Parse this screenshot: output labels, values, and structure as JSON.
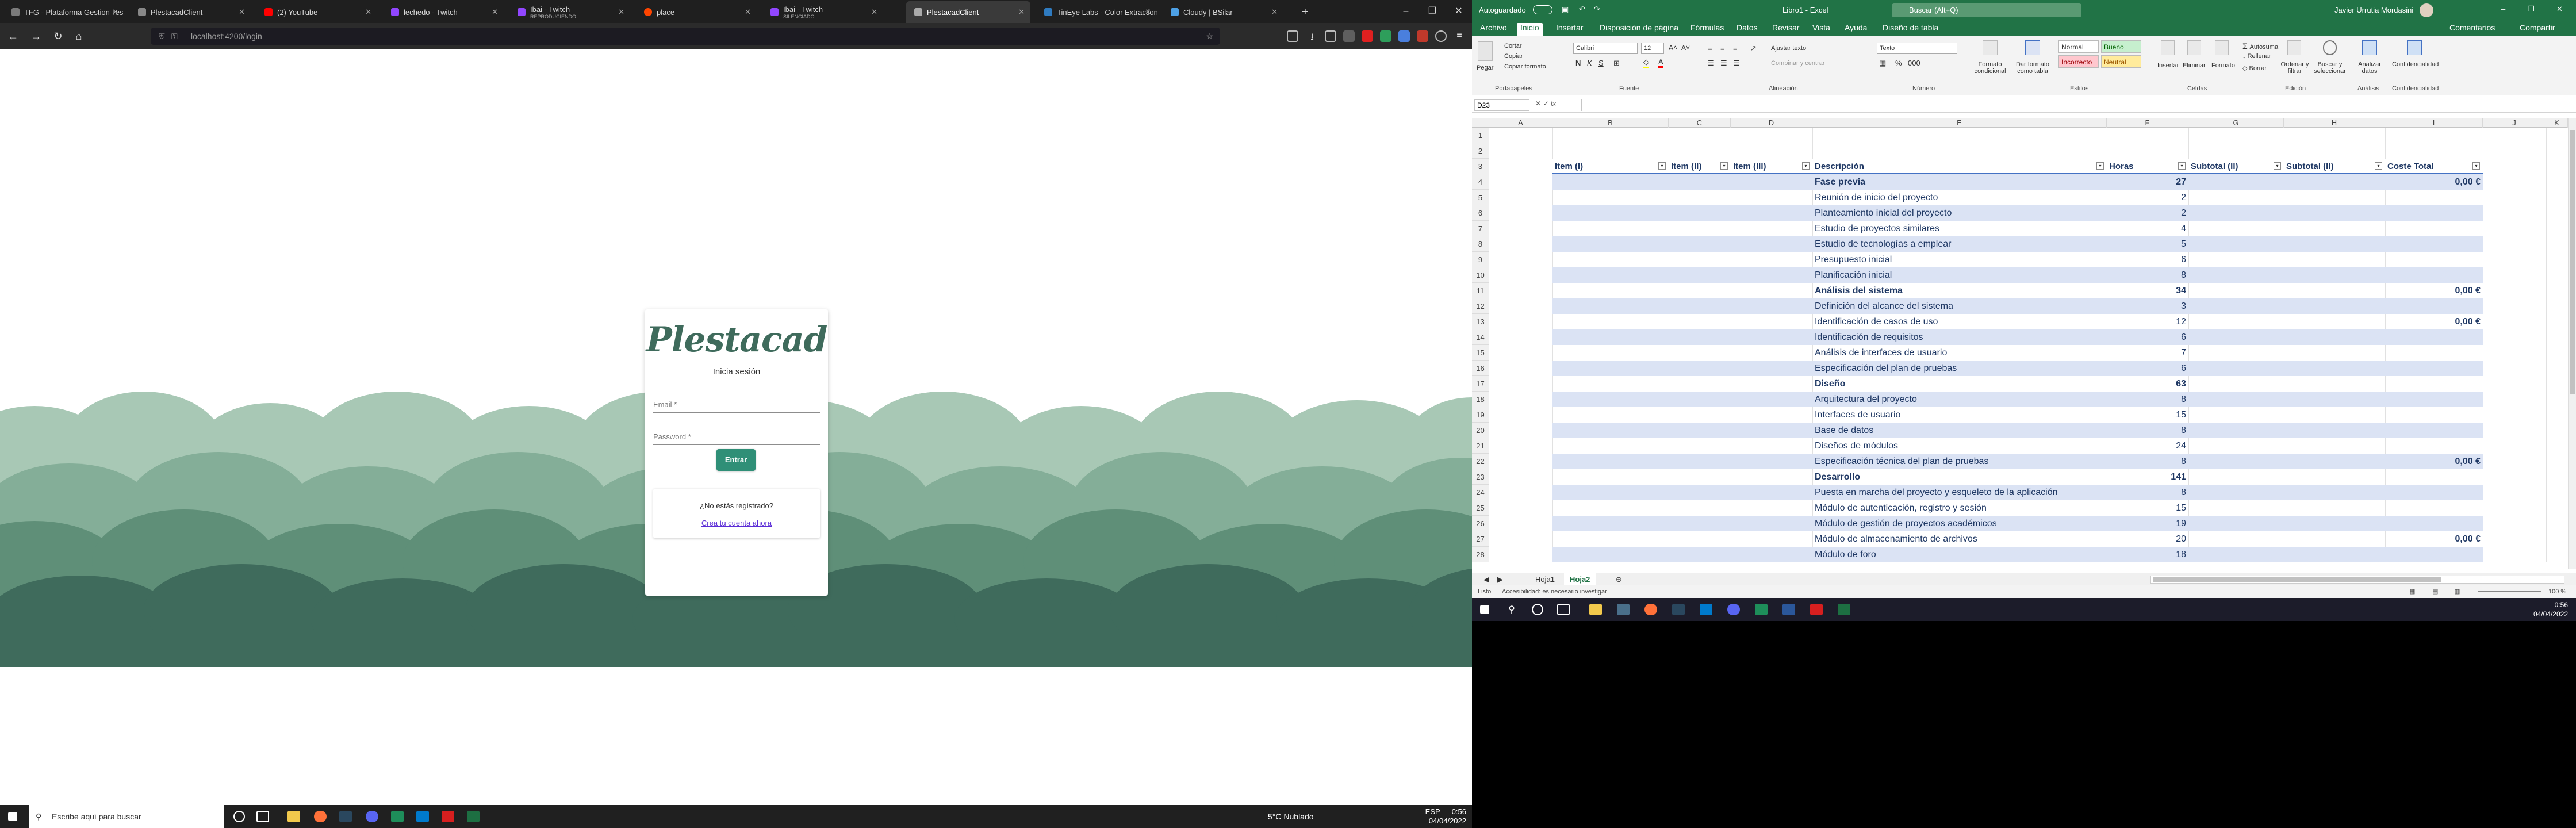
{
  "browser": {
    "tabs": [
      {
        "label": "TFG - Plataforma Gestion Tes",
        "color": "#7a7a7a",
        "sub": ""
      },
      {
        "label": "PlestacadClient",
        "color": "#888888",
        "sub": ""
      },
      {
        "label": "(2) YouTube",
        "color": "#ff0000",
        "sub": ""
      },
      {
        "label": "lechedo - Twitch",
        "color": "#9146ff",
        "sub": ""
      },
      {
        "label": "Ibai - Twitch",
        "color": "#9146ff",
        "sub": "REPRODUCIENDO"
      },
      {
        "label": "place",
        "color": "#ff4500",
        "sub": ""
      },
      {
        "label": "Ibai - Twitch",
        "color": "#9146ff",
        "sub": "SILENCIADO"
      },
      {
        "label": "PlestacadClient",
        "color": "#888888",
        "sub": ""
      },
      {
        "label": "TinEye Labs - Color Extraction",
        "color": "#2f7bc0",
        "sub": ""
      },
      {
        "label": "Cloudy | BSilar",
        "color": "#4da1e6",
        "sub": ""
      }
    ],
    "url": "localhost:4200/login",
    "login": {
      "logo": "Plestacad",
      "subtitle": "Inicia sesión",
      "email_label": "Email *",
      "password_label": "Password *",
      "submit": "Entrar",
      "register_question": "¿No estás registrado?",
      "register_link": "Crea tu cuenta ahora"
    }
  },
  "taskbar_left": {
    "search_placeholder": "Escribe aquí para buscar",
    "weather": "5°C  Nublado",
    "lang": "ESP",
    "time": "0:56",
    "date": "04/04/2022"
  },
  "excel": {
    "title": "Libro1 - Excel",
    "autosave": "Autoguardado",
    "search": "Buscar (Alt+Q)",
    "user": "Javier Urrutia Mordasini",
    "menu": [
      "Archivo",
      "Inicio",
      "Insertar",
      "Disposición de página",
      "Fórmulas",
      "Datos",
      "Revisar",
      "Vista",
      "Ayuda",
      "Diseño de tabla"
    ],
    "comments": "Comentarios",
    "share": "Compartir",
    "ribbon": {
      "clipboard": "Portapapeles",
      "cut": "Cortar",
      "copy": "Copiar",
      "format_painter": "Copiar formato",
      "paste": "Pegar",
      "font_group": "Fuente",
      "font": "Calibri",
      "font_size": "12",
      "align_group": "Alineación",
      "wrap": "Ajustar texto",
      "merge": "Combinar y centrar",
      "number_group": "Número",
      "number_format": "Texto",
      "styles_group": "Estilos",
      "cond_format": "Formato condicional",
      "as_table": "Dar formato como tabla",
      "style_normal": "Normal",
      "style_good": "Bueno",
      "style_bad": "Incorrecto",
      "style_neutral": "Neutral",
      "cells_group": "Celdas",
      "insert": "Insertar",
      "delete": "Eliminar",
      "format": "Formato",
      "edit_group": "Edición",
      "autosum": "Autosuma",
      "fill": "Rellenar",
      "clear": "Borrar",
      "sort": "Ordenar y filtrar",
      "find": "Buscar y seleccionar",
      "analysis_group": "Análisis",
      "analyze": "Analizar datos",
      "sens_group": "Confidencialidad",
      "sensitivity": "Confidencialidad"
    },
    "namebox": "D23",
    "columns": [
      "A",
      "B",
      "C",
      "D",
      "E",
      "F",
      "G",
      "H",
      "I",
      "J",
      "K"
    ],
    "headers": [
      "Item (I)",
      "Item (II)",
      "Item (III)",
      "Descripción",
      "Horas",
      "Subtotal (II)",
      "Subtotal (II)",
      "Coste Total"
    ],
    "rows": [
      {
        "n": "1",
        "desc": "",
        "hours": "",
        "cost": "",
        "bold": false,
        "band": "none"
      },
      {
        "n": "2",
        "desc": "",
        "hours": "",
        "cost": "",
        "bold": false,
        "band": "none"
      },
      {
        "n": "3",
        "desc": "",
        "hours": "",
        "cost": "",
        "bold": false,
        "band": "header"
      },
      {
        "n": "4",
        "desc": "Fase previa",
        "hours": "27",
        "cost": "0,00 €",
        "bold": true,
        "band": "alt"
      },
      {
        "n": "5",
        "desc": "Reunión de inicio del proyecto",
        "hours": "2",
        "cost": "",
        "bold": false,
        "band": "plain"
      },
      {
        "n": "6",
        "desc": "Planteamiento inicial del proyecto",
        "hours": "2",
        "cost": "",
        "bold": false,
        "band": "alt"
      },
      {
        "n": "7",
        "desc": "Estudio de proyectos similares",
        "hours": "4",
        "cost": "",
        "bold": false,
        "band": "plain"
      },
      {
        "n": "8",
        "desc": "Estudio de tecnologías a emplear",
        "hours": "5",
        "cost": "",
        "bold": false,
        "band": "alt"
      },
      {
        "n": "9",
        "desc": "Presupuesto inicial",
        "hours": "6",
        "cost": "",
        "bold": false,
        "band": "plain"
      },
      {
        "n": "10",
        "desc": "Planificación inicial",
        "hours": "8",
        "cost": "",
        "bold": false,
        "band": "alt"
      },
      {
        "n": "11",
        "desc": "Análisis del sistema",
        "hours": "34",
        "cost": "0,00 €",
        "bold": true,
        "band": "plain"
      },
      {
        "n": "12",
        "desc": "Definición del alcance del sistema",
        "hours": "3",
        "cost": "",
        "bold": false,
        "band": "alt"
      },
      {
        "n": "13",
        "desc": "Identificación de casos de uso",
        "hours": "12",
        "cost": "0,00 €",
        "bold": false,
        "band": "plain"
      },
      {
        "n": "14",
        "desc": "Identificación de requisitos",
        "hours": "6",
        "cost": "",
        "bold": false,
        "band": "alt"
      },
      {
        "n": "15",
        "desc": "Análisis de interfaces de usuario",
        "hours": "7",
        "cost": "",
        "bold": false,
        "band": "plain"
      },
      {
        "n": "16",
        "desc": "Especificación del plan de pruebas",
        "hours": "6",
        "cost": "",
        "bold": false,
        "band": "alt"
      },
      {
        "n": "17",
        "desc": "Diseño",
        "hours": "63",
        "cost": "",
        "bold": true,
        "band": "plain"
      },
      {
        "n": "18",
        "desc": "Arquitectura del proyecto",
        "hours": "8",
        "cost": "",
        "bold": false,
        "band": "alt"
      },
      {
        "n": "19",
        "desc": "Interfaces de usuario",
        "hours": "15",
        "cost": "",
        "bold": false,
        "band": "plain"
      },
      {
        "n": "20",
        "desc": "Base de datos",
        "hours": "8",
        "cost": "",
        "bold": false,
        "band": "alt"
      },
      {
        "n": "21",
        "desc": "Diseños de módulos",
        "hours": "24",
        "cost": "",
        "bold": false,
        "band": "plain"
      },
      {
        "n": "22",
        "desc": "Especificación técnica del plan de pruebas",
        "hours": "8",
        "cost": "0,00 €",
        "bold": false,
        "band": "alt"
      },
      {
        "n": "23",
        "desc": "Desarrollo",
        "hours": "141",
        "cost": "",
        "bold": true,
        "band": "plain"
      },
      {
        "n": "24",
        "desc": "Puesta en marcha del proyecto y esqueleto de la aplicación",
        "hours": "8",
        "cost": "",
        "bold": false,
        "band": "alt"
      },
      {
        "n": "25",
        "desc": "Módulo de autenticación, registro y sesión",
        "hours": "15",
        "cost": "",
        "bold": false,
        "band": "plain"
      },
      {
        "n": "26",
        "desc": "Módulo de gestión de proyectos académicos",
        "hours": "19",
        "cost": "",
        "bold": false,
        "band": "alt"
      },
      {
        "n": "27",
        "desc": "Módulo de almacenamiento de archivos",
        "hours": "20",
        "cost": "0,00 €",
        "bold": false,
        "band": "plain"
      },
      {
        "n": "28",
        "desc": "Módulo de foro",
        "hours": "18",
        "cost": "",
        "bold": false,
        "band": "alt"
      }
    ],
    "sheets": [
      "Hoja1",
      "Hoja2"
    ],
    "active_sheet": "Hoja2",
    "status_ready": "Listo",
    "status_access": "Accesibilidad: es necesario investigar",
    "zoom": "100 %"
  },
  "taskbar_right": {
    "time": "0:56",
    "date": "04/04/2022"
  }
}
